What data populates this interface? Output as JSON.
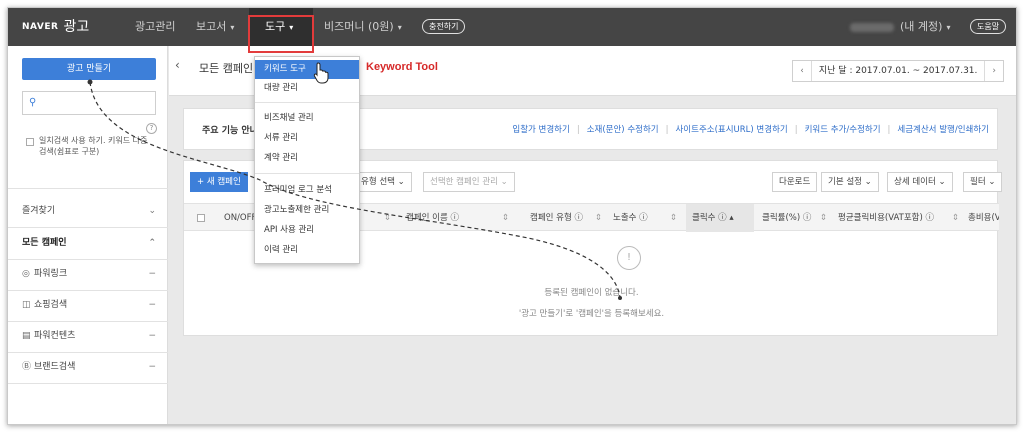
{
  "header": {
    "logo_brand": "NAVER",
    "logo_text": "광고",
    "nav": [
      {
        "label": "광고관리",
        "chevron": ""
      },
      {
        "label": "보고서",
        "chevron": "▾"
      },
      {
        "label": "도구",
        "chevron": "▾"
      },
      {
        "label": "비즈머니 (0원)",
        "chevron": "▾"
      }
    ],
    "charge_button": "충전하기",
    "account_label": "(내 계정)",
    "account_chevron": "▾",
    "help_button": "도움말"
  },
  "sidebar": {
    "create_button": "광고 만들기",
    "search_placeholder": "",
    "checkbox_label": "일치검색 사용 하기. 키워드 다중검색(쉼표로 구분)",
    "help_mark": "?",
    "rows": [
      {
        "label": "즐겨찾기",
        "right": "⌄",
        "icon": ""
      },
      {
        "label": "모든 캠페인",
        "right": "⌃",
        "icon": ""
      },
      {
        "label": "파워링크",
        "right": "−",
        "icon": "◎"
      },
      {
        "label": "쇼핑검색",
        "right": "−",
        "icon": "◫"
      },
      {
        "label": "파워컨텐츠",
        "right": "−",
        "icon": "▤"
      },
      {
        "label": "브랜드검색",
        "right": "−",
        "icon": "Ⓑ"
      }
    ]
  },
  "main": {
    "back": "‹",
    "title": "모든 캠페인",
    "date_prev": "‹",
    "date_range": "지난 달 : 2017.07.01. ~ 2017.07.31.",
    "date_next": "›",
    "features": {
      "label": "주요 기능 안내",
      "links": [
        "입찰가 변경하기",
        "소재(문안) 수정하기",
        "사이트주소(표시URL) 변경하기",
        "키워드 추가/수정하기",
        "세금계산서 발행/인쇄하기"
      ]
    },
    "toolbar": {
      "new_campaign": "+ 새 캠페인",
      "type_select": "유형 선택 ⌄",
      "manage_select": "선택한 캠페인 관리 ⌄",
      "download": "다운로드",
      "default_settings": "기본 설정 ⌄",
      "detail_data": "상세 데이터 ⌄",
      "filter": "필터 ⌄"
    },
    "columns": [
      "ON/OFF",
      "캠페인 이름 ⓘ",
      "캠페인 유형 ⓘ",
      "노출수 ⓘ",
      "클릭수 ⓘ",
      "클릭률(%) ⓘ",
      "평균클릭비용(VAT포함) ⓘ",
      "총비용(VAT포"
    ],
    "sort_mark": "⇕",
    "sort_up": "▴",
    "empty_icon": "!",
    "empty_line1": "등록된 캠페인이 없습니다.",
    "empty_line2": "'광고 만들기'로 '캠페인'을 등록해보세요."
  },
  "dropdown": {
    "groups": [
      [
        "키워드 도구",
        "대량 관리"
      ],
      [
        "비즈채널 관리",
        "서류 관리",
        "계약 관리"
      ],
      [
        "프리미엄 로그 분석",
        "광고노출제한 관리",
        "API 사용 관리",
        "이력 관리"
      ]
    ],
    "highlighted": "키워드 도구"
  },
  "annotation": {
    "callout": "Keyword Tool",
    "color": "#d62929"
  }
}
